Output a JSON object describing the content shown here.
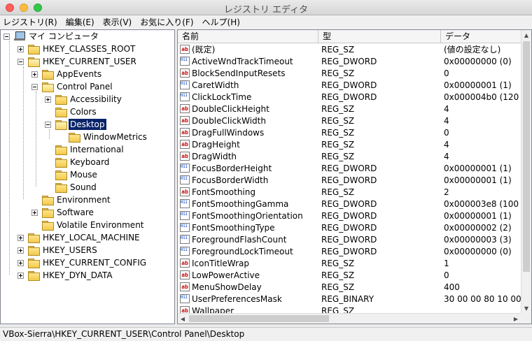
{
  "window": {
    "title": "レジストリ エディタ"
  },
  "menu": [
    {
      "label": "レジストリ(R)"
    },
    {
      "label": "編集(E)"
    },
    {
      "label": "表示(V)"
    },
    {
      "label": "お気に入り(F)"
    },
    {
      "label": "ヘルプ(H)"
    }
  ],
  "tree": {
    "root": "マイ コンピュータ",
    "items": [
      {
        "label": "HKEY_CLASSES_ROOT"
      },
      {
        "label": "HKEY_CURRENT_USER"
      },
      {
        "label": "AppEvents"
      },
      {
        "label": "Control Panel"
      },
      {
        "label": "Accessibility"
      },
      {
        "label": "Colors"
      },
      {
        "label": "Desktop"
      },
      {
        "label": "WindowMetrics"
      },
      {
        "label": "International"
      },
      {
        "label": "Keyboard"
      },
      {
        "label": "Mouse"
      },
      {
        "label": "Sound"
      },
      {
        "label": "Environment"
      },
      {
        "label": "Software"
      },
      {
        "label": "Volatile Environment"
      },
      {
        "label": "HKEY_LOCAL_MACHINE"
      },
      {
        "label": "HKEY_USERS"
      },
      {
        "label": "HKEY_CURRENT_CONFIG"
      },
      {
        "label": "HKEY_DYN_DATA"
      }
    ]
  },
  "list": {
    "columns": {
      "name": "名前",
      "type": "型",
      "data": "データ"
    },
    "rows": [
      {
        "name": "(既定)",
        "type": "REG_SZ",
        "data": "(値の設定なし)",
        "icon": "string-value-icon"
      },
      {
        "name": "ActiveWndTrackTimeout",
        "type": "REG_DWORD",
        "data": "0x00000000 (0)",
        "icon": "dword-value-icon"
      },
      {
        "name": "BlockSendInputResets",
        "type": "REG_SZ",
        "data": "0",
        "icon": "string-value-icon"
      },
      {
        "name": "CaretWidth",
        "type": "REG_DWORD",
        "data": "0x00000001 (1)",
        "icon": "dword-value-icon"
      },
      {
        "name": "ClickLockTime",
        "type": "REG_DWORD",
        "data": "0x000004b0 (120",
        "icon": "dword-value-icon"
      },
      {
        "name": "DoubleClickHeight",
        "type": "REG_SZ",
        "data": "4",
        "icon": "string-value-icon"
      },
      {
        "name": "DoubleClickWidth",
        "type": "REG_SZ",
        "data": "4",
        "icon": "string-value-icon"
      },
      {
        "name": "DragFullWindows",
        "type": "REG_SZ",
        "data": "0",
        "icon": "string-value-icon"
      },
      {
        "name": "DragHeight",
        "type": "REG_SZ",
        "data": "4",
        "icon": "string-value-icon"
      },
      {
        "name": "DragWidth",
        "type": "REG_SZ",
        "data": "4",
        "icon": "string-value-icon"
      },
      {
        "name": "FocusBorderHeight",
        "type": "REG_DWORD",
        "data": "0x00000001 (1)",
        "icon": "dword-value-icon"
      },
      {
        "name": "FocusBorderWidth",
        "type": "REG_DWORD",
        "data": "0x00000001 (1)",
        "icon": "dword-value-icon"
      },
      {
        "name": "FontSmoothing",
        "type": "REG_SZ",
        "data": "2",
        "icon": "string-value-icon"
      },
      {
        "name": "FontSmoothingGamma",
        "type": "REG_DWORD",
        "data": "0x000003e8 (100",
        "icon": "dword-value-icon"
      },
      {
        "name": "FontSmoothingOrientation",
        "type": "REG_DWORD",
        "data": "0x00000001 (1)",
        "icon": "dword-value-icon"
      },
      {
        "name": "FontSmoothingType",
        "type": "REG_DWORD",
        "data": "0x00000002 (2)",
        "icon": "dword-value-icon"
      },
      {
        "name": "ForegroundFlashCount",
        "type": "REG_DWORD",
        "data": "0x00000003 (3)",
        "icon": "dword-value-icon"
      },
      {
        "name": "ForegroundLockTimeout",
        "type": "REG_DWORD",
        "data": "0x00000000 (0)",
        "icon": "dword-value-icon"
      },
      {
        "name": "IconTitleWrap",
        "type": "REG_SZ",
        "data": "1",
        "icon": "string-value-icon"
      },
      {
        "name": "LowPowerActive",
        "type": "REG_SZ",
        "data": "0",
        "icon": "string-value-icon"
      },
      {
        "name": "MenuShowDelay",
        "type": "REG_SZ",
        "data": "400",
        "icon": "string-value-icon"
      },
      {
        "name": "UserPreferencesMask",
        "type": "REG_BINARY",
        "data": "30 00 00 80 10 00",
        "icon": "binary-value-icon"
      },
      {
        "name": "Wallpaper",
        "type": "REG_SZ",
        "data": "",
        "icon": "string-value-icon"
      }
    ]
  },
  "statusbar": {
    "path": "VBox-Sierra\\HKEY_CURRENT_USER\\Control Panel\\Desktop"
  },
  "icons": {
    "string_value_glyph": "ab",
    "dword_value_glyph": "011 110"
  }
}
